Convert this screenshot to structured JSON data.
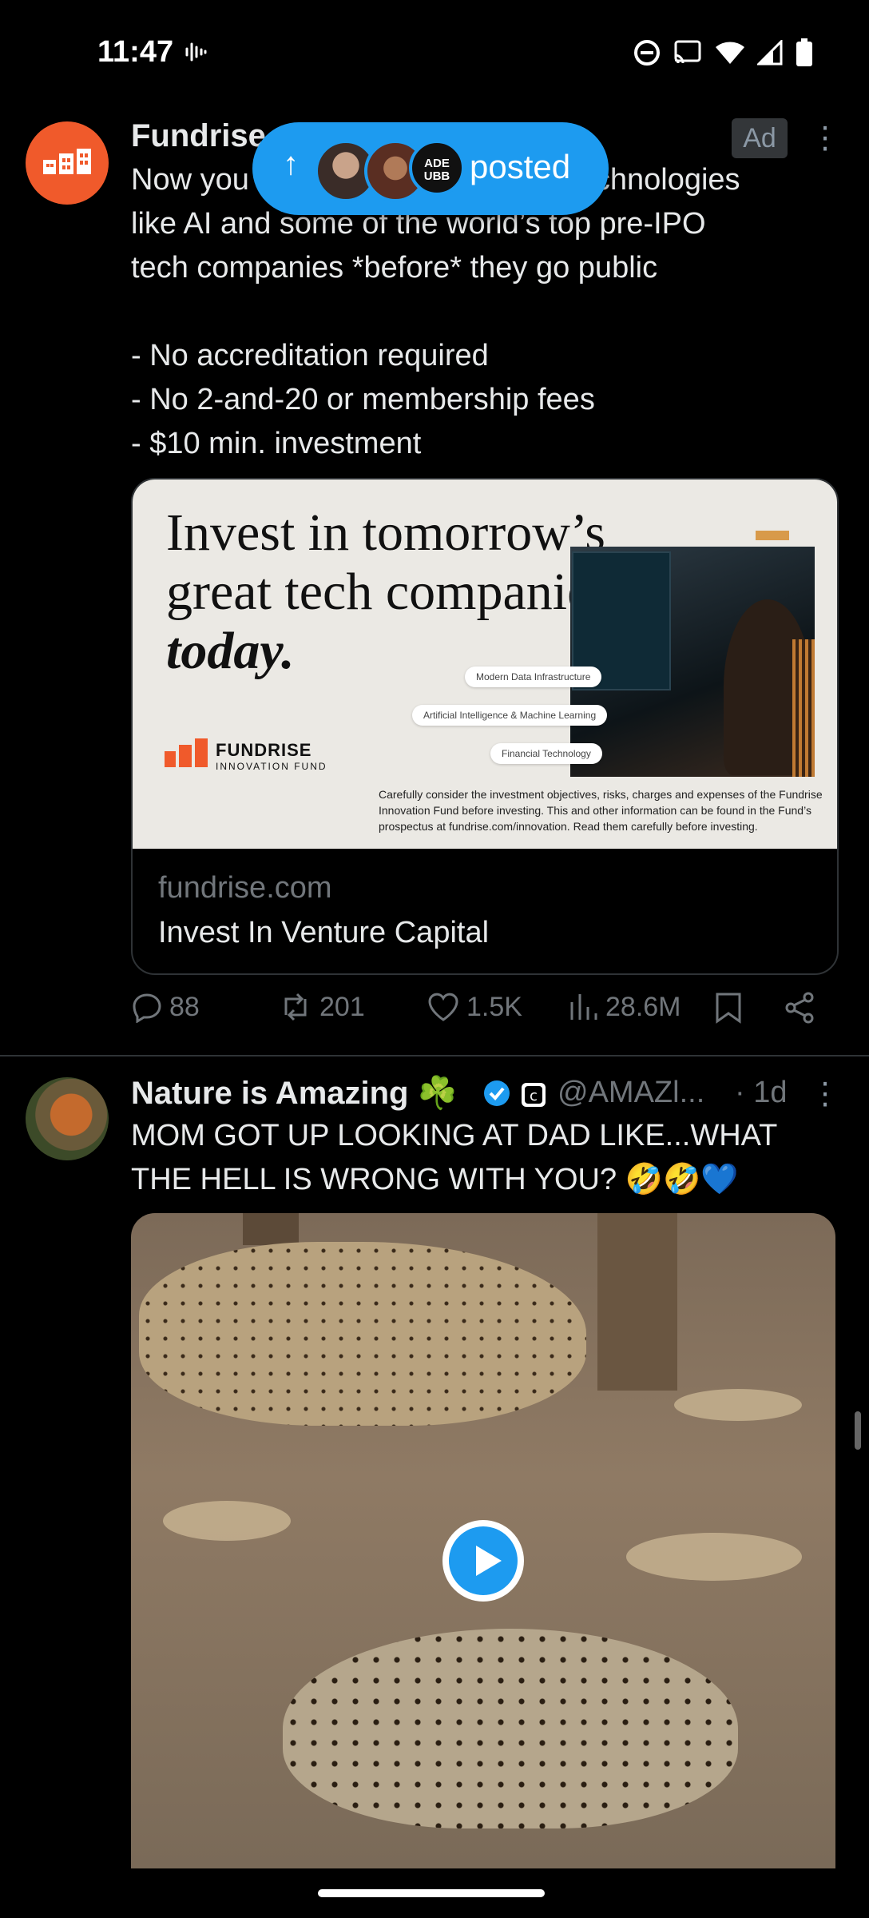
{
  "status_bar": {
    "time": "11:47",
    "icons": [
      "voice-waveform-icon",
      "dnd-icon",
      "cast-icon",
      "wifi-icon",
      "signal-icon",
      "battery-icon"
    ]
  },
  "new_posts_pill": {
    "label": "posted",
    "avatars": [
      "avatar-1",
      "avatar-2",
      "avatar-3"
    ],
    "avatar3_text": "ADE UBB"
  },
  "post1": {
    "author": "Fundrise",
    "ad_label": "Ad",
    "text": "Now you can invest in emerging technologies\nlike AI and some of the world’s top pre-IPO\ntech companies *before* they go public\n\n- No accreditation required\n- No 2-and-20 or membership fees\n- $10 min. investment",
    "card": {
      "headline_line1": "Invest in tomorrow’s",
      "headline_line2": "great tech companies,",
      "headline_line3": "today.",
      "chips": [
        "Modern Data Infrastructure",
        "Artificial Intelligence & Machine Learning",
        "Financial Technology"
      ],
      "brand": "FUNDRISE",
      "brand_sub": "INNOVATION FUND",
      "disclaimer": "Carefully consider the investment objectives, risks, charges and expenses of the Fundrise Innovation Fund before investing. This and other information can be found in the Fund’s prospectus at fundrise.com/innovation. Read them carefully before investing.",
      "domain": "fundrise.com",
      "title": "Invest In Venture Capital"
    },
    "actions": {
      "replies": "88",
      "reposts": "201",
      "likes": "1.5K",
      "views": "28.6M"
    }
  },
  "post2": {
    "author": "Nature is Amazing ☘️",
    "handle": "@AMAZl...",
    "time": "· 1d",
    "text": "MOM GOT UP LOOKING AT DAD LIKE...WHAT\nTHE HELL IS WRONG WITH YOU? 🤣🤣💙"
  },
  "colors": {
    "accent": "#1d9bf0",
    "fundrise_orange": "#f05a2b",
    "muted": "#71767b",
    "divider": "#2f3336"
  }
}
